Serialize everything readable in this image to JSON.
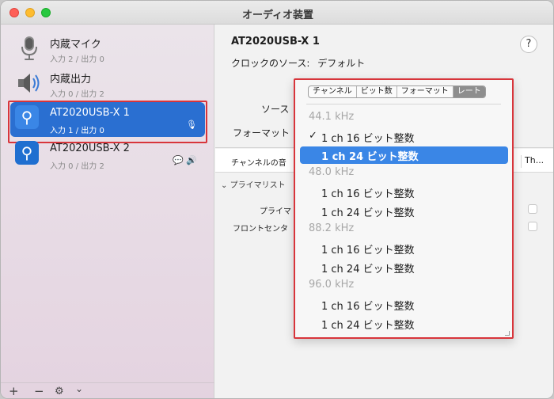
{
  "window": {
    "title": "オーディオ装置"
  },
  "sidebar": {
    "devices": [
      {
        "name": "内蔵マイク",
        "io": "入力 2 / 出力 0",
        "icon": "microphone-icon"
      },
      {
        "name": "内蔵出力",
        "io": "入力 0 / 出力 2",
        "icon": "speaker-icon"
      },
      {
        "name": "AT2020USB-X 1",
        "io": "入力 1 / 出力 0",
        "icon": "usb-icon",
        "side_icon": "🎙"
      },
      {
        "name": "AT2020USB-X 2",
        "io": "入力 0 / 出力 2",
        "icon": "usb-icon",
        "side_icon": "💬 🔊"
      }
    ],
    "bottom": {
      "add": "+",
      "remove": "−",
      "gear": "⚙",
      "chevron": "⌄"
    }
  },
  "main": {
    "title": "AT2020USB-X 1",
    "clock_label": "クロックのソース:",
    "clock_value": "デフォルト",
    "help": "?",
    "source_label": "ソース",
    "format_label": "フォーマット",
    "table": {
      "channel_header": "チャンネルの音",
      "right_header": "Th..."
    },
    "primary_label": "プライマリスト",
    "rows": [
      "プライマ",
      "フロントセンタ"
    ]
  },
  "popup": {
    "tabs": [
      "チャンネル",
      "ビット数",
      "フォーマット",
      "レート"
    ],
    "active_tab": "レート",
    "groups": [
      {
        "rate": "44.1 kHz",
        "options": [
          "1 ch 16 ビット整数",
          "1 ch 24 ビット整数"
        ]
      },
      {
        "rate": "48.0 kHz",
        "options": [
          "1 ch 16 ビット整数",
          "1 ch 24 ビット整数"
        ]
      },
      {
        "rate": "88.2 kHz",
        "options": [
          "1 ch 16 ビット整数",
          "1 ch 24 ビット整数"
        ]
      },
      {
        "rate": "96.0 kHz",
        "options": [
          "1 ch 16 ビット整数",
          "1 ch 24 ビット整数"
        ]
      }
    ],
    "checked_mark": "✓"
  },
  "colors": {
    "selection": "#2a6fd1",
    "highlight": "#3a86e6",
    "annotation_frame": "#d8353b"
  }
}
